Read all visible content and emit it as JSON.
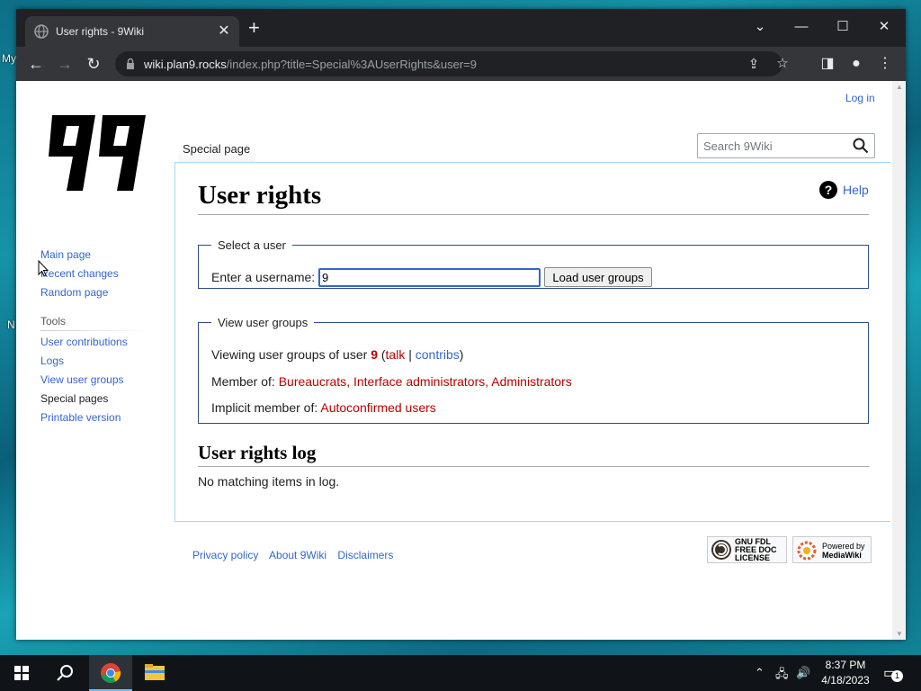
{
  "desktop": {
    "edge_text_my": "My",
    "edge_text_n": "N"
  },
  "browser": {
    "tab_title": "User rights - 9Wiki",
    "new_tab": "+",
    "url_host": "wiki.plan9.rocks",
    "url_path": "/index.php?title=Special%3AUserRights&user=9"
  },
  "page": {
    "login": "Log in",
    "logo_text": "99",
    "nav": {
      "main_page": "Main page",
      "recent_changes": "Recent changes",
      "random_page": "Random page"
    },
    "tools": {
      "heading": "Tools",
      "items": [
        "User contributions",
        "Logs",
        "View user groups",
        "Special pages",
        "Printable version"
      ]
    },
    "tab_special": "Special page",
    "search_placeholder": "Search 9Wiki",
    "title": "User rights",
    "help": "Help",
    "select_user": {
      "legend": "Select a user",
      "label": "Enter a username:",
      "value": "9",
      "button": "Load user groups"
    },
    "view_groups": {
      "legend": "View user groups",
      "viewing_prefix": "Viewing user groups of user ",
      "user": "9",
      "talk": "talk",
      "contribs": "contribs",
      "member_of_label": "Member of: ",
      "groups": [
        "Bureaucrats",
        "Interface administrators",
        "Administrators"
      ],
      "implicit_label": "Implicit member of: ",
      "implicit_groups": "Autoconfirmed users"
    },
    "log_heading": "User rights log",
    "log_empty": "No matching items in log.",
    "footer": [
      "Privacy policy",
      "About 9Wiki",
      "Disclaimers"
    ],
    "badges": {
      "gfdl": [
        "GNU FDL",
        "FREE DOC",
        "LICENSE"
      ],
      "mediawiki": [
        "Powered by",
        "MediaWiki"
      ]
    }
  },
  "taskbar": {
    "time": "8:37 PM",
    "date": "4/18/2023",
    "notifications": "1"
  }
}
